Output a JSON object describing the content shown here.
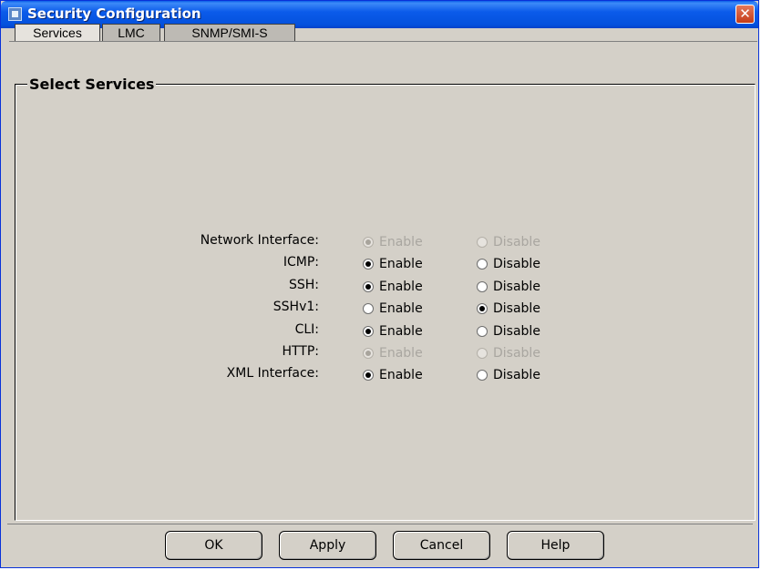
{
  "window": {
    "title": "Security Configuration",
    "close_glyph": "✕"
  },
  "tabs": [
    {
      "label": "Services"
    },
    {
      "label": "LMC"
    },
    {
      "label": "SNMP/SMI-S"
    }
  ],
  "panel": {
    "title": "Select Services"
  },
  "options": {
    "enable_label": "Enable",
    "disable_label": "Disable"
  },
  "services": [
    {
      "label": "Network Interface:",
      "selected": "enable",
      "disabled": true
    },
    {
      "label": "ICMP:",
      "selected": "enable",
      "disabled": false
    },
    {
      "label": "SSH:",
      "selected": "enable",
      "disabled": false
    },
    {
      "label": "SSHv1:",
      "selected": "disable",
      "disabled": false
    },
    {
      "label": "CLI:",
      "selected": "enable",
      "disabled": false
    },
    {
      "label": "HTTP:",
      "selected": "enable",
      "disabled": true
    },
    {
      "label": "XML Interface:",
      "selected": "enable",
      "disabled": false
    }
  ],
  "buttons": {
    "ok": "OK",
    "apply": "Apply",
    "cancel": "Cancel",
    "help": "Help"
  }
}
